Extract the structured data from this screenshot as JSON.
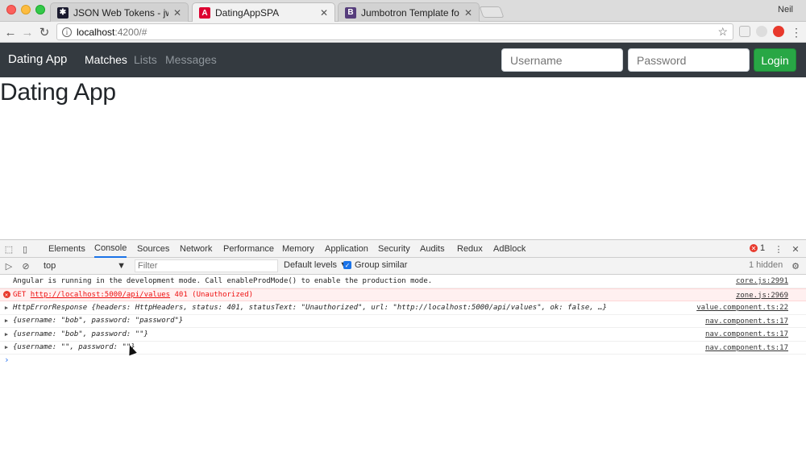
{
  "browser": {
    "tabs": [
      {
        "title": "JSON Web Tokens - jwt.io",
        "favicon": "jwt-icon",
        "color": "#1a1a2e"
      },
      {
        "title": "DatingAppSPA",
        "favicon": "angular-icon",
        "color": "#dd0031"
      },
      {
        "title": "Jumbotron Template for Boots",
        "favicon": "bootstrap-icon",
        "color": "#563d7c"
      }
    ],
    "user": "Neil",
    "url_host": "localhost",
    "url_rest": ":4200/#"
  },
  "app": {
    "brand": "Dating App",
    "nav": [
      "Matches",
      "Lists",
      "Messages"
    ],
    "username_placeholder": "Username",
    "password_placeholder": "Password",
    "login_label": "Login",
    "heading": "Dating App"
  },
  "devtools": {
    "tabs": [
      "Elements",
      "Console",
      "Sources",
      "Network",
      "Performance",
      "Memory",
      "Application",
      "Security",
      "Audits",
      "Redux",
      "AdBlock"
    ],
    "active_tab": "Console",
    "error_count": "1",
    "context": "top",
    "filter_placeholder": "Filter",
    "levels": "Default levels ▼",
    "group_similar": "Group similar",
    "hidden": "1 hidden",
    "messages": [
      {
        "type": "log",
        "text": "Angular is running in the development mode. Call enableProdMode() to enable the production mode.",
        "source": "core.js:2991"
      },
      {
        "type": "error",
        "prefix": "GET ",
        "url": "http://localhost:5000/api/values",
        "suffix": " 401 (Unauthorized)",
        "source": "zone.js:2969"
      },
      {
        "type": "object",
        "label": "HttpErrorResponse",
        "text": "HttpErrorResponse {headers: HttpHeaders, status: 401, statusText: \"Unauthorized\", url: \"http://localhost:5000/api/values\", ok: false, …}",
        "source": "value.component.ts:22"
      },
      {
        "type": "object",
        "text": "{username: \"bob\", password: \"password\"}",
        "source": "nav.component.ts:17"
      },
      {
        "type": "object",
        "text": "{username: \"bob\", password: \"\"}",
        "source": "nav.component.ts:17"
      },
      {
        "type": "object",
        "text": "{username: \"\", password: \"\"}",
        "source": "nav.component.ts:17"
      }
    ],
    "prompt": "›"
  }
}
